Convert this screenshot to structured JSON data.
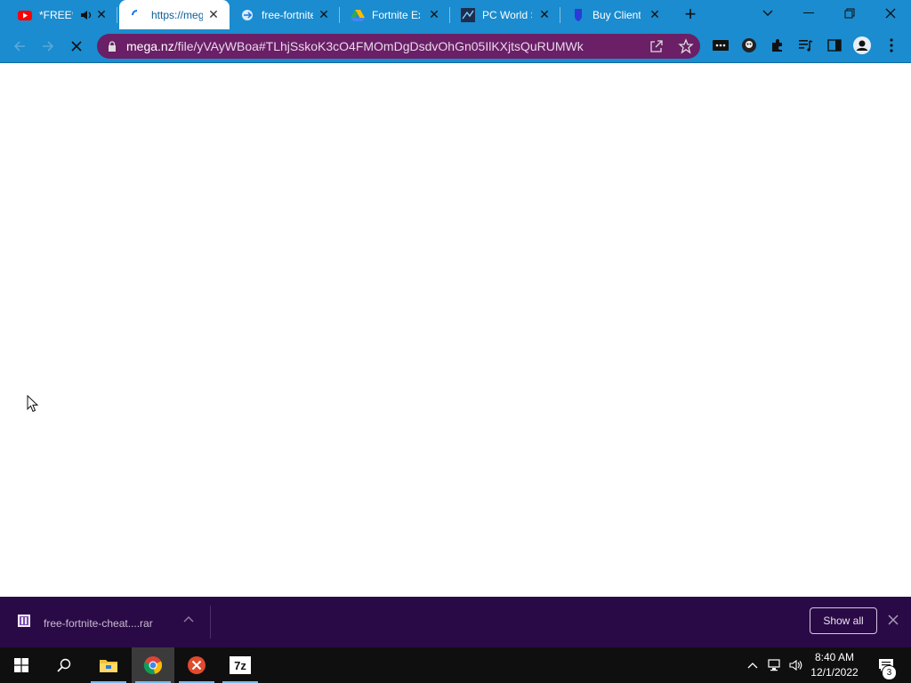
{
  "browser": {
    "tabs": [
      {
        "title": "*FREE*",
        "favicon": "youtube-icon",
        "audio": true
      },
      {
        "title": "https://mega",
        "favicon": "loading-spinner-icon",
        "active": true
      },
      {
        "title": "free-fortnite",
        "favicon": "link-icon"
      },
      {
        "title": "Fortnite Ex",
        "favicon": "google-drive-icon"
      },
      {
        "title": "PC World S",
        "favicon": "pcworld-icon"
      },
      {
        "title": "Buy Client",
        "favicon": "shield-icon"
      }
    ],
    "address_bar": {
      "domain": "mega.nz",
      "path": "/file/yVAyWBoa#TLhjSskoK3cO4FMOmDgDsdvOhGn05IlKXjtsQuRUMWk"
    }
  },
  "download_bar": {
    "file_name": "free-fortnite-cheat....rar",
    "show_all_label": "Show all"
  },
  "taskbar": {
    "time": "8:40 AM",
    "date": "12/1/2022",
    "notification_count": "3"
  },
  "colors": {
    "tab_strip": "#1a8ccf",
    "omnibox": "#6a1f66",
    "download_bar": "#2a0a46",
    "taskbar": "#0f0f10"
  }
}
